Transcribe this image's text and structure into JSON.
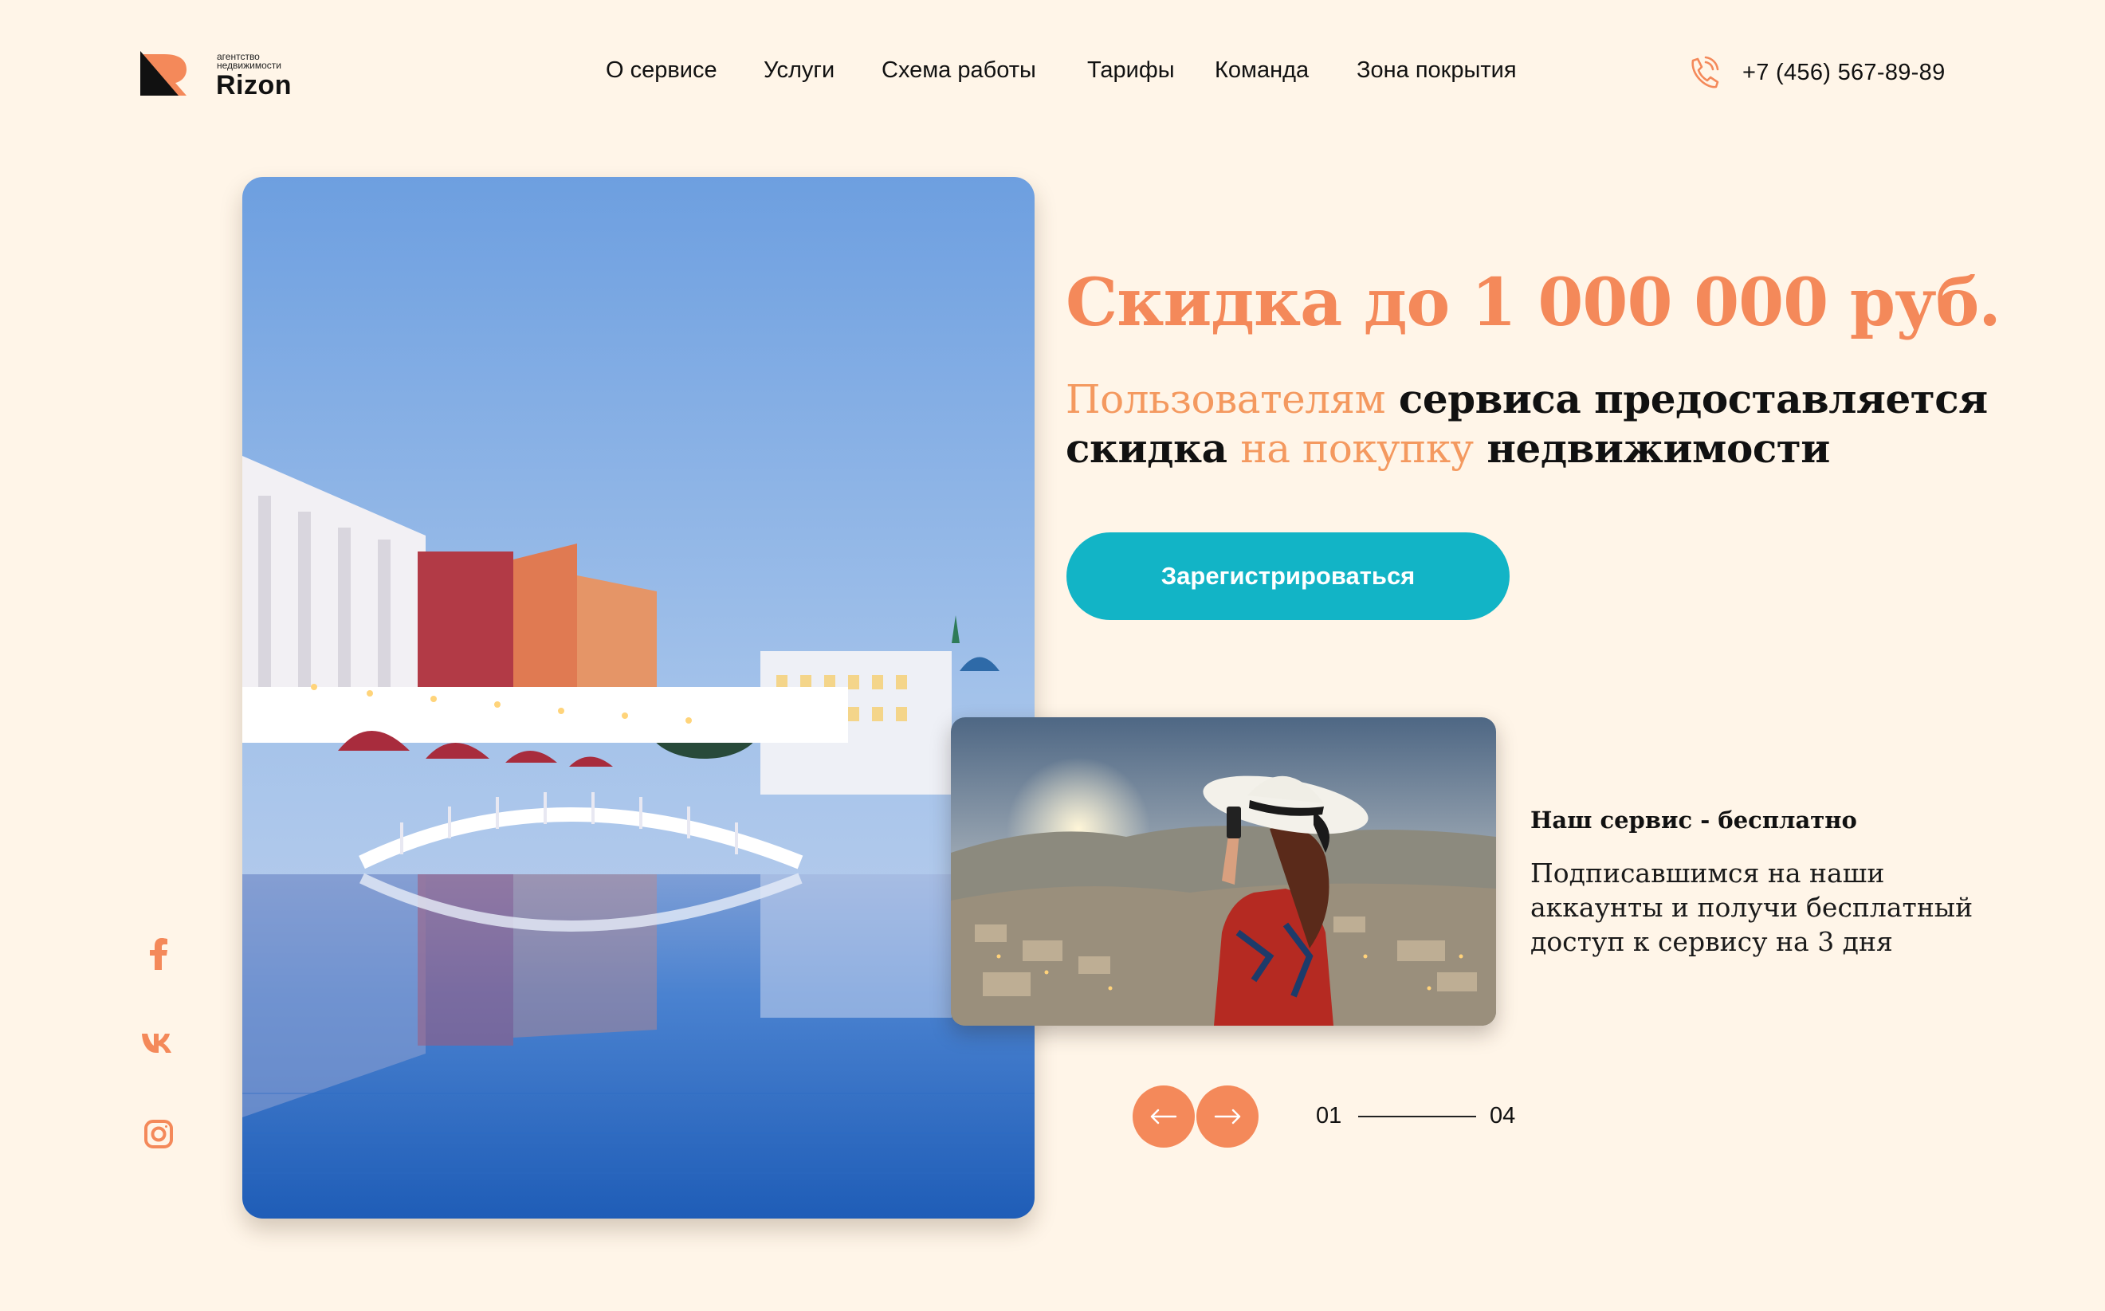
{
  "brand": {
    "subtitle_line1": "агентство",
    "subtitle_line2": "недвижимости",
    "name": "Rizon",
    "logo_icon": "r-logo-icon",
    "accent_color": "#f4895a",
    "logo_dark_color": "#111111"
  },
  "nav": {
    "items": [
      {
        "label": "О сервисе"
      },
      {
        "label": "Услуги"
      },
      {
        "label": "Схема работы"
      },
      {
        "label": "Тарифы"
      },
      {
        "label": "Команда"
      },
      {
        "label": "Зона покрытия"
      }
    ]
  },
  "contact": {
    "phone": "+7 (456) 567-89-89",
    "icon": "phone-icon",
    "icon_color": "#f4895a"
  },
  "hero": {
    "title": "Скидка до 1 000 000 руб.",
    "subtitle": {
      "part1": "Пользователям",
      "part2": " сервиса предоставляется скидка ",
      "part3": "на покупку",
      "part4": " недвижимости"
    },
    "title_color": "#f4895a",
    "cta_label": "Зарегистрироваться",
    "cta_color": "#12b4c6"
  },
  "photos": {
    "main": "resort-pool-photo",
    "secondary": "traveler-hat-photo"
  },
  "promo": {
    "title": "Наш сервис - бесплатно",
    "text": "Подписавшимся на наши аккаунты и получи бесплатный доступ к сервису на 3 дня"
  },
  "slider": {
    "prev_icon": "arrow-left-icon",
    "next_icon": "arrow-right-icon",
    "current": "01",
    "total": "04",
    "button_color": "#f4895a"
  },
  "social": {
    "items": [
      "facebook-icon",
      "vk-icon",
      "instagram-icon"
    ],
    "color": "#f4895a"
  }
}
